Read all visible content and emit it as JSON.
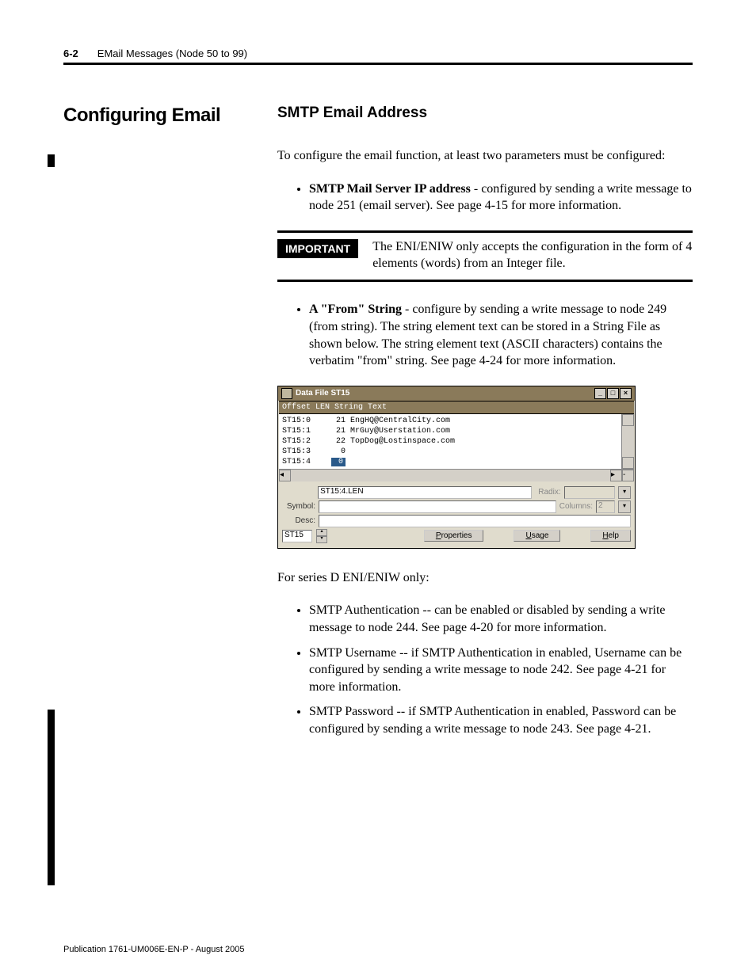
{
  "header": {
    "pagenum": "6-2",
    "title": "EMail Messages (Node 50 to 99)"
  },
  "section_heading": "Configuring Email",
  "sub_heading": "SMTP Email Address",
  "intro": "To configure the email function, at least two parameters must be configured:",
  "bullet1": {
    "bold": "SMTP Mail Server IP address",
    "rest": " - configured by sending a write message to node 251 (email server). See page 4-15 for more information."
  },
  "important": {
    "label": "IMPORTANT",
    "text": "The ENI/ENIW only accepts the configuration in the form of 4 elements (words) from an Integer file."
  },
  "bullet2": {
    "bold": "A \"From\" String",
    "rest": " - configure by sending a write message to node 249 (from string). The string element text can be stored in a String File as shown below. The string element text (ASCII characters) contains the verbatim \"from\" string. See page 4-24 for more information."
  },
  "figure": {
    "title": "Data File ST15",
    "col_header": "Offset    LEN String Text",
    "rows": [
      {
        "offset": "ST15:0",
        "len": "21",
        "text": "EngHQ@CentralCity.com"
      },
      {
        "offset": "ST15:1",
        "len": "21",
        "text": "MrGuy@Userstation.com"
      },
      {
        "offset": "ST15:2",
        "len": "22",
        "text": "TopDog@Lostinspace.com"
      },
      {
        "offset": "ST15:3",
        "len": "0",
        "text": ""
      },
      {
        "offset": "ST15:4",
        "len": "0",
        "text": "",
        "selected": true
      }
    ],
    "nav_field": "ST15:4.LEN",
    "radix_label": "Radix:",
    "symbol_label": "Symbol:",
    "columns_label": "Columns:",
    "columns_value": "2",
    "desc_label": "Desc:",
    "file_field": "ST15",
    "btn_properties": "Properties",
    "btn_usage": "Usage",
    "btn_help": "Help"
  },
  "series_d_intro": "For series D ENI/ENIW only:",
  "series_d_bullets": [
    "SMTP Authentication -- can be enabled or disabled by sending a write message to node 244. See page 4-20 for more information.",
    "SMTP Username -- if SMTP Authentication in enabled, Username can be configured by sending a write message to node 242. See page 4-21 for more information.",
    "SMTP Password -- if SMTP Authentication in enabled, Password can be configured by sending a write message to node 243. See page 4-21."
  ],
  "footer": "Publication 1761-UM006E-EN-P - August 2005"
}
